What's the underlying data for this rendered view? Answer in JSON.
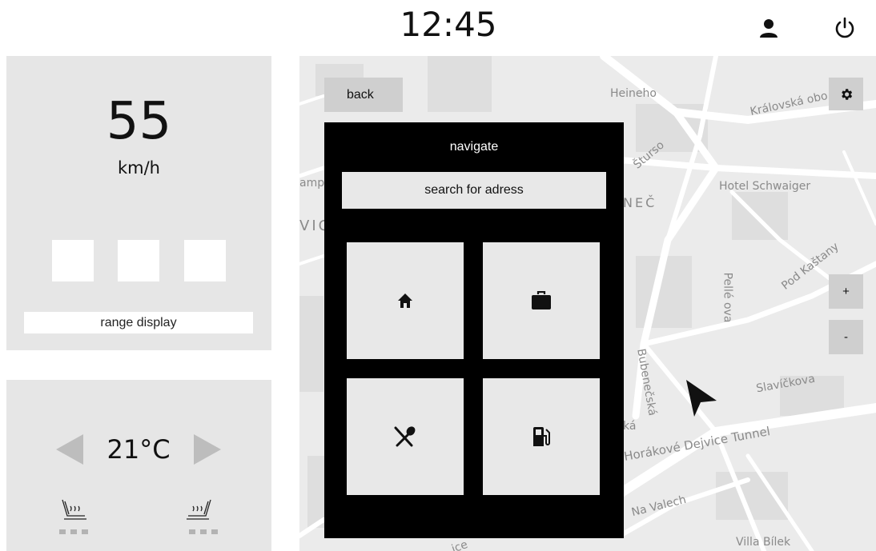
{
  "status_bar": {
    "clock": "12:45",
    "user_icon": "person-icon",
    "power_icon": "power-icon"
  },
  "speed_panel": {
    "speed": "55",
    "unit": "km/h",
    "range_label": "range display"
  },
  "climate_panel": {
    "temperature": "21°C",
    "left_arrow_icon": "triangle-left-icon",
    "right_arrow_icon": "triangle-right-icon",
    "left_seat_icon": "seat-heat-icon",
    "right_seat_icon": "seat-heat-icon"
  },
  "map": {
    "labels": {
      "heineho": "Heineho",
      "kralovska": "Královská obo",
      "stursova": "Šturso",
      "amp": "amp",
      "vic": "VIC",
      "nec": "NEČ",
      "hotel": "Hotel Schwaiger",
      "pod_kastany": "Pod Kaštany",
      "pellova": "Pellé ova",
      "bubenecska": "Bubenečská",
      "slavickova": "Slavíčkova",
      "ska": "ká",
      "tunnel": "Horákové Dejvice Tunnel",
      "na_valech": "Na Valech",
      "villa": "Villa Bílek",
      "ice": "ice"
    },
    "back_label": "back",
    "zoom_in_label": "+",
    "zoom_out_label": "-",
    "settings_icon": "gear-icon",
    "pointer_icon": "navigation-arrow-icon"
  },
  "navigate_modal": {
    "title": "navigate",
    "search_placeholder": "search for adress",
    "tiles": [
      {
        "icon": "home-icon"
      },
      {
        "icon": "briefcase-icon"
      },
      {
        "icon": "restaurant-icon"
      },
      {
        "icon": "fuel-station-icon"
      }
    ]
  },
  "colors": {
    "panel_bg": "#e6e6e6",
    "modal_bg": "#000000",
    "button_bg": "#cfcfcf",
    "tile_bg": "#e8e8e8"
  }
}
